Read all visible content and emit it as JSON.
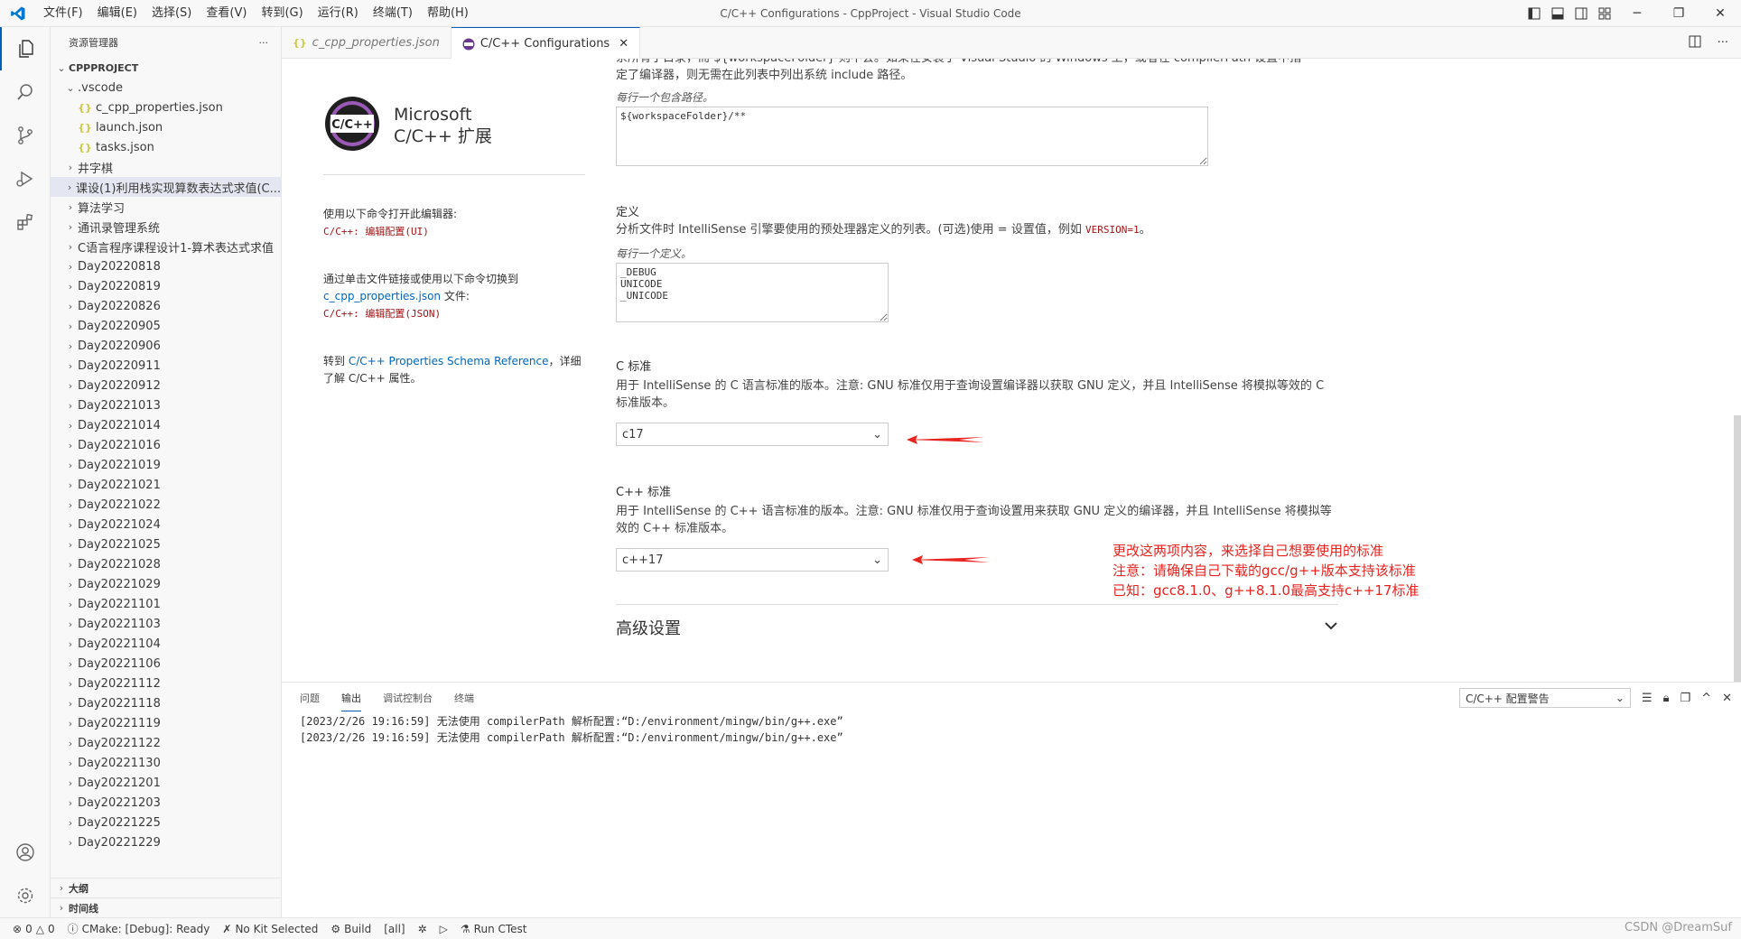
{
  "window": {
    "title": "C/C++ Configurations - CppProject - Visual Studio Code",
    "menu": [
      "文件(F)",
      "编辑(E)",
      "选择(S)",
      "查看(V)",
      "转到(G)",
      "运行(R)",
      "终端(T)",
      "帮助(H)"
    ]
  },
  "sidebar": {
    "header": "资源管理器",
    "more": "···",
    "project": "CPPPROJECT",
    "vscode_folder": ".vscode",
    "vscode_files": [
      "c_cpp_properties.json",
      "launch.json",
      "tasks.json"
    ],
    "folders": [
      "井字棋",
      "课设(1)利用栈实现算数表达式求值(C...",
      "算法学习",
      "通讯录管理系统",
      "C语言程序课程设计1-算术表达式求值",
      "Day20220818",
      "Day20220819",
      "Day20220826",
      "Day20220905",
      "Day20220906",
      "Day20220911",
      "Day20220912",
      "Day20221013",
      "Day20221014",
      "Day20221016",
      "Day20221019",
      "Day20221021",
      "Day20221022",
      "Day20221024",
      "Day20221025",
      "Day20221028",
      "Day20221029",
      "Day20221101",
      "Day20221103",
      "Day20221104",
      "Day20221106",
      "Day20221112",
      "Day20221118",
      "Day20221119",
      "Day20221122",
      "Day20221130",
      "Day20221201",
      "Day20221203",
      "Day20221225",
      "Day20221229"
    ],
    "outline": "大纲",
    "timeline": "时间线"
  },
  "tabs": [
    {
      "label": "c_cpp_properties.json",
      "active": false
    },
    {
      "label": "C/C++ Configurations",
      "active": true
    }
  ],
  "ext": {
    "badge": "C/C++",
    "name_line1": "Microsoft",
    "name_line2": "C/C++ 扩展",
    "block1_text": "使用以下命令打开此编辑器:",
    "block1_cmd": "C/C++: 编辑配置(UI)",
    "block2_text1": "通过单击文件链接或使用以下命令切换到",
    "block2_link": "c_cpp_properties.json",
    "block2_text2": " 文件:",
    "block2_cmd": "C/C++: 编辑配置(JSON)",
    "block3_pre": "转到 ",
    "block3_link": "C/C++ Properties Schema Reference",
    "block3_post": "，详细了解 C/C++ 属性。"
  },
  "settings": {
    "include_desc_top1": "系所有子目录，而 ${workspaceFolder} 则不会。如果在安装了 Visual Studio 的 Windows 上，或者在 compilerPath 设置中指",
    "include_desc_top2": "定了编译器，则无需在此列表中列出系统 include 路径。",
    "include_note": "每行一个包含路径。",
    "include_value": "${workspaceFolder}/**",
    "defines_title": "定义",
    "defines_desc_pre": "分析文件时 IntelliSense 引擎要使用的预处理器定义的列表。(可选)使用 = 设置值，例如 ",
    "defines_desc_code": "VERSION=1",
    "defines_desc_post": "。",
    "defines_note": "每行一个定义。",
    "defines_value": "_DEBUG\nUNICODE\n_UNICODE",
    "cstd_title": "C 标准",
    "cstd_desc": "用于 IntelliSense 的 C 语言标准的版本。注意: GNU 标准仅用于查询设置编译器以获取 GNU 定义，并且 IntelliSense 将模拟等效的 C 标准版本。",
    "cstd_value": "c17",
    "cppstd_title": "C++ 标准",
    "cppstd_desc": "用于 IntelliSense 的 C++ 语言标准的版本。注意: GNU 标准仅用于查询设置用来获取 GNU 定义的编译器，并且 IntelliSense 将模拟等效的 C++ 标准版本。",
    "cppstd_value": "c++17",
    "advanced": "高级设置"
  },
  "annotation": {
    "line1": "更改这两项内容，来选择自己想要使用的标准",
    "line2": "注意：请确保自己下载的gcc/g++版本支持该标准",
    "line3": "已知：gcc8.1.0、g++8.1.0最高支持c++17标准"
  },
  "panel": {
    "tabs": [
      "问题",
      "输出",
      "调试控制台",
      "终端"
    ],
    "active_tab": "输出",
    "channel": "C/C++ 配置警告",
    "lines": [
      "[2023/2/26 19:16:59] 无法使用 compilerPath 解析配置:“D:/environment/mingw/bin/g++.exe”",
      "[2023/2/26 19:16:59] 无法使用 compilerPath 解析配置:“D:/environment/mingw/bin/g++.exe”"
    ]
  },
  "status": {
    "errors": "0",
    "warnings": "0",
    "cmake": "CMake: [Debug]: Ready",
    "kit": "No Kit Selected",
    "build": "Build",
    "all": "[all]",
    "ctest": "Run CTest",
    "watermark": "CSDN @DreamSuf"
  },
  "colors": {
    "accent": "#005fb8",
    "annotation": "#e8231f",
    "code_red": "#a31515",
    "link": "#0066bf"
  }
}
